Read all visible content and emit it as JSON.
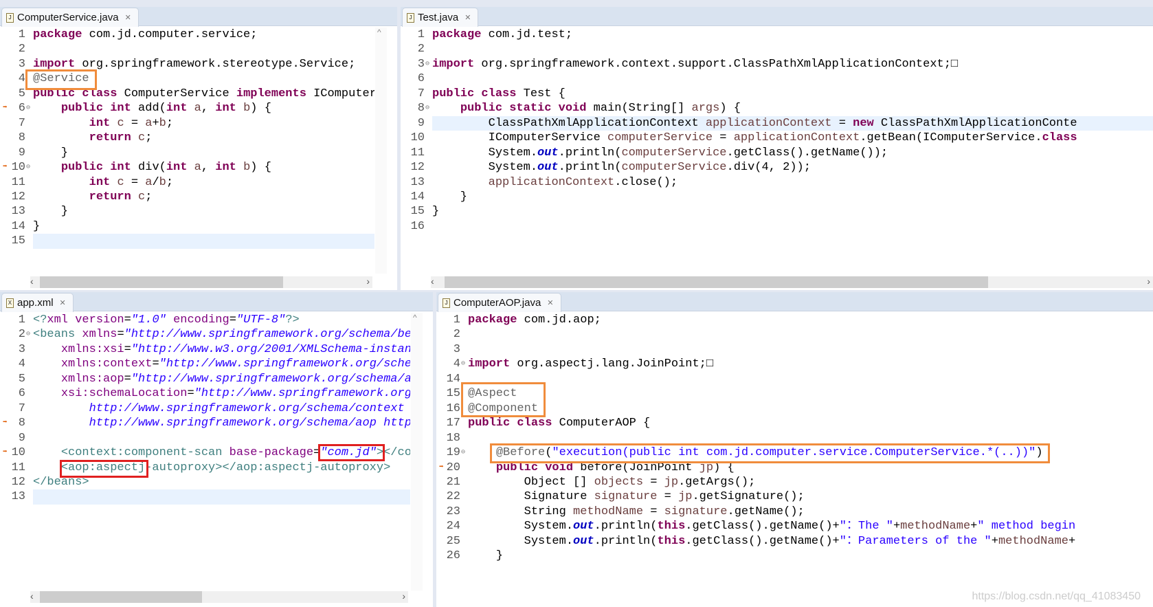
{
  "colors": {
    "highlight_orange": "#f08c3c",
    "highlight_red": "#e02020"
  },
  "panes": [
    {
      "id": "tl",
      "tab": "ComputerService.java",
      "icon": "java-file-icon",
      "current": 14,
      "lines": [
        [
          "1",
          [
            [
              "k",
              "package"
            ],
            [
              "p",
              " com.jd.computer.service;"
            ]
          ]
        ],
        [
          "2",
          []
        ],
        [
          "3",
          [
            [
              "k",
              "import"
            ],
            [
              "p",
              " org.springframework.stereotype.Service;"
            ]
          ]
        ],
        [
          "4",
          [
            [
              "a",
              "@Service"
            ]
          ]
        ],
        [
          "5",
          [
            [
              "k",
              "public"
            ],
            [
              "p",
              " "
            ],
            [
              "k",
              "class"
            ],
            [
              "p",
              " ComputerService "
            ],
            [
              "k",
              "implements"
            ],
            [
              "p",
              " IComputer"
            ]
          ]
        ],
        [
          "6",
          [
            [
              "p",
              "    "
            ],
            [
              "k",
              "public"
            ],
            [
              "p",
              " "
            ],
            [
              "k",
              "int"
            ],
            [
              "p",
              " add("
            ],
            [
              "k",
              "int"
            ],
            [
              "p",
              " "
            ],
            [
              "v",
              "a"
            ],
            [
              "p",
              ", "
            ],
            [
              "k",
              "int"
            ],
            [
              "p",
              " "
            ],
            [
              "v",
              "b"
            ],
            [
              "p",
              ") {"
            ]
          ]
        ],
        [
          "7",
          [
            [
              "p",
              "        "
            ],
            [
              "k",
              "int"
            ],
            [
              "p",
              " "
            ],
            [
              "v",
              "c"
            ],
            [
              "p",
              " = "
            ],
            [
              "v",
              "a"
            ],
            [
              "p",
              "+"
            ],
            [
              "v",
              "b"
            ],
            [
              "p",
              ";"
            ]
          ]
        ],
        [
          "8",
          [
            [
              "p",
              "        "
            ],
            [
              "k",
              "return"
            ],
            [
              "p",
              " "
            ],
            [
              "v",
              "c"
            ],
            [
              "p",
              ";"
            ]
          ]
        ],
        [
          "9",
          [
            [
              "p",
              "    }"
            ]
          ]
        ],
        [
          "10",
          [
            [
              "p",
              "    "
            ],
            [
              "k",
              "public"
            ],
            [
              "p",
              " "
            ],
            [
              "k",
              "int"
            ],
            [
              "p",
              " div("
            ],
            [
              "k",
              "int"
            ],
            [
              "p",
              " "
            ],
            [
              "v",
              "a"
            ],
            [
              "p",
              ", "
            ],
            [
              "k",
              "int"
            ],
            [
              "p",
              " "
            ],
            [
              "v",
              "b"
            ],
            [
              "p",
              ") {"
            ]
          ]
        ],
        [
          "11",
          [
            [
              "p",
              "        "
            ],
            [
              "k",
              "int"
            ],
            [
              "p",
              " "
            ],
            [
              "v",
              "c"
            ],
            [
              "p",
              " = "
            ],
            [
              "v",
              "a"
            ],
            [
              "p",
              "/"
            ],
            [
              "v",
              "b"
            ],
            [
              "p",
              ";"
            ]
          ]
        ],
        [
          "12",
          [
            [
              "p",
              "        "
            ],
            [
              "k",
              "return"
            ],
            [
              "p",
              " "
            ],
            [
              "v",
              "c"
            ],
            [
              "p",
              ";"
            ]
          ]
        ],
        [
          "13",
          [
            [
              "p",
              "    }"
            ]
          ]
        ],
        [
          "14",
          [
            [
              "p",
              "}"
            ]
          ]
        ],
        [
          "15",
          []
        ]
      ]
    },
    {
      "id": "tr",
      "tab": "Test.java",
      "icon": "java-file-icon",
      "current": 6,
      "lines": [
        [
          "1",
          [
            [
              "k",
              "package"
            ],
            [
              "p",
              " com.jd.test;"
            ]
          ]
        ],
        [
          "2",
          []
        ],
        [
          "3",
          [
            [
              "k",
              "import"
            ],
            [
              "p",
              " org.springframework.context.support.ClassPathXmlApplicationContext;□"
            ]
          ]
        ],
        [
          "6",
          []
        ],
        [
          "7",
          [
            [
              "k",
              "public"
            ],
            [
              "p",
              " "
            ],
            [
              "k",
              "class"
            ],
            [
              "p",
              " Test {"
            ]
          ]
        ],
        [
          "8",
          [
            [
              "p",
              "    "
            ],
            [
              "k",
              "public"
            ],
            [
              "p",
              " "
            ],
            [
              "k",
              "static"
            ],
            [
              "p",
              " "
            ],
            [
              "k",
              "void"
            ],
            [
              "p",
              " main(String[] "
            ],
            [
              "v",
              "args"
            ],
            [
              "p",
              ") {"
            ]
          ]
        ],
        [
          "9",
          [
            [
              "p",
              "        ClassPathXmlApplicationContext "
            ],
            [
              "v",
              "applicationContext"
            ],
            [
              "p",
              " = "
            ],
            [
              "k",
              "new"
            ],
            [
              "p",
              " ClassPathXmlApplicationConte"
            ]
          ]
        ],
        [
          "10",
          [
            [
              "p",
              "        IComputerService "
            ],
            [
              "v",
              "computerService"
            ],
            [
              "p",
              " = "
            ],
            [
              "v",
              "applicationContext"
            ],
            [
              "p",
              ".getBean(IComputerService."
            ],
            [
              "k",
              "class"
            ]
          ]
        ],
        [
          "11",
          [
            [
              "p",
              "        System."
            ],
            [
              "f",
              "out"
            ],
            [
              "p",
              ".println("
            ],
            [
              "v",
              "computerService"
            ],
            [
              "p",
              ".getClass().getName());"
            ]
          ]
        ],
        [
          "12",
          [
            [
              "p",
              "        System."
            ],
            [
              "f",
              "out"
            ],
            [
              "p",
              ".println("
            ],
            [
              "v",
              "computerService"
            ],
            [
              "p",
              ".div(4, 2));"
            ]
          ]
        ],
        [
          "13",
          [
            [
              "p",
              "        "
            ],
            [
              "v",
              "applicationContext"
            ],
            [
              "p",
              ".close();"
            ]
          ]
        ],
        [
          "14",
          [
            [
              "p",
              "    }"
            ]
          ]
        ],
        [
          "15",
          [
            [
              "p",
              "}"
            ]
          ]
        ],
        [
          "16",
          []
        ]
      ]
    },
    {
      "id": "bl",
      "tab": "app.xml",
      "icon": "xml-file-icon",
      "current": 12,
      "lines": [
        [
          "1",
          [
            [
              "t",
              "<?"
            ],
            [
              "n",
              "xml"
            ],
            [
              "p",
              " "
            ],
            [
              "n",
              "version"
            ],
            [
              "p",
              "="
            ],
            [
              "x",
              "\"1.0\""
            ],
            [
              "p",
              " "
            ],
            [
              "n",
              "encoding"
            ],
            [
              "p",
              "="
            ],
            [
              "x",
              "\"UTF-8\""
            ],
            [
              "t",
              "?>"
            ]
          ]
        ],
        [
          "2",
          [
            [
              "t",
              "<beans"
            ],
            [
              "p",
              " "
            ],
            [
              "n",
              "xmlns"
            ],
            [
              "p",
              "="
            ],
            [
              "x",
              "\"http://www.springframework.org/schema/be"
            ]
          ]
        ],
        [
          "3",
          [
            [
              "p",
              "    "
            ],
            [
              "n",
              "xmlns:xsi"
            ],
            [
              "p",
              "="
            ],
            [
              "x",
              "\"http://www.w3.org/2001/XMLSchema-instan"
            ]
          ]
        ],
        [
          "4",
          [
            [
              "p",
              "    "
            ],
            [
              "n",
              "xmlns:context"
            ],
            [
              "p",
              "="
            ],
            [
              "x",
              "\"http://www.springframework.org/sche"
            ]
          ]
        ],
        [
          "5",
          [
            [
              "p",
              "    "
            ],
            [
              "n",
              "xmlns:aop"
            ],
            [
              "p",
              "="
            ],
            [
              "x",
              "\"http://www.springframework.org/schema/a"
            ]
          ]
        ],
        [
          "6",
          [
            [
              "p",
              "    "
            ],
            [
              "n",
              "xsi:schemaLocation"
            ],
            [
              "p",
              "="
            ],
            [
              "x",
              "\"http://www.springframework.org"
            ]
          ]
        ],
        [
          "7",
          [
            [
              "p",
              "        "
            ],
            [
              "x",
              "http://www.springframework.org/schema/context"
            ]
          ]
        ],
        [
          "8",
          [
            [
              "p",
              "        "
            ],
            [
              "x",
              "http://www.springframework.org/schema/aop http"
            ]
          ]
        ],
        [
          "9",
          []
        ],
        [
          "10",
          [
            [
              "p",
              "    "
            ],
            [
              "t",
              "<context:component-scan"
            ],
            [
              "p",
              " "
            ],
            [
              "n",
              "base-package"
            ],
            [
              "p",
              "="
            ],
            [
              "x",
              "\"com.jd\""
            ],
            [
              "t",
              "></co"
            ]
          ]
        ],
        [
          "11",
          [
            [
              "p",
              "    "
            ],
            [
              "t",
              "<aop:aspectj-autoproxy></aop:aspectj-autoproxy>"
            ]
          ]
        ],
        [
          "12",
          [
            [
              "t",
              "</beans>"
            ]
          ]
        ],
        [
          "13",
          []
        ]
      ]
    },
    {
      "id": "br",
      "tab": "ComputerAOP.java",
      "icon": "java-file-icon",
      "current": -1,
      "lines": [
        [
          "1",
          [
            [
              "k",
              "package"
            ],
            [
              "p",
              " com.jd.aop;"
            ]
          ]
        ],
        [
          "2",
          []
        ],
        [
          "3",
          []
        ],
        [
          "4",
          [
            [
              "k",
              "import"
            ],
            [
              "p",
              " org.aspectj.lang.JoinPoint;□"
            ]
          ]
        ],
        [
          "14",
          []
        ],
        [
          "15",
          [
            [
              "a",
              "@Aspect"
            ]
          ]
        ],
        [
          "16",
          [
            [
              "a",
              "@Component"
            ]
          ]
        ],
        [
          "17",
          [
            [
              "k",
              "public"
            ],
            [
              "p",
              " "
            ],
            [
              "k",
              "class"
            ],
            [
              "p",
              " ComputerAOP {"
            ]
          ]
        ],
        [
          "18",
          []
        ],
        [
          "19",
          [
            [
              "p",
              "    "
            ],
            [
              "a",
              "@Before"
            ],
            [
              "p",
              "("
            ],
            [
              "s",
              "\"execution(public int com.jd.computer.service.ComputerService.*(..))\""
            ],
            [
              "p",
              ")"
            ]
          ]
        ],
        [
          "20",
          [
            [
              "p",
              "    "
            ],
            [
              "k",
              "public"
            ],
            [
              "p",
              " "
            ],
            [
              "k",
              "void"
            ],
            [
              "p",
              " before(JoinPoint "
            ],
            [
              "v",
              "jp"
            ],
            [
              "p",
              ") {"
            ]
          ]
        ],
        [
          "21",
          [
            [
              "p",
              "        Object [] "
            ],
            [
              "v",
              "objects"
            ],
            [
              "p",
              " = "
            ],
            [
              "v",
              "jp"
            ],
            [
              "p",
              ".getArgs();"
            ]
          ]
        ],
        [
          "22",
          [
            [
              "p",
              "        Signature "
            ],
            [
              "v",
              "signature"
            ],
            [
              "p",
              " = "
            ],
            [
              "v",
              "jp"
            ],
            [
              "p",
              ".getSignature();"
            ]
          ]
        ],
        [
          "23",
          [
            [
              "p",
              "        String "
            ],
            [
              "v",
              "methodName"
            ],
            [
              "p",
              " = "
            ],
            [
              "v",
              "signature"
            ],
            [
              "p",
              ".getName();"
            ]
          ]
        ],
        [
          "24",
          [
            [
              "p",
              "        System."
            ],
            [
              "f",
              "out"
            ],
            [
              "p",
              ".println("
            ],
            [
              "k",
              "this"
            ],
            [
              "p",
              ".getClass().getName()+"
            ],
            [
              "s",
              "\"：The \""
            ],
            [
              "p",
              "+"
            ],
            [
              "v",
              "methodName"
            ],
            [
              "p",
              "+"
            ],
            [
              "s",
              "\" method begin"
            ]
          ]
        ],
        [
          "25",
          [
            [
              "p",
              "        System."
            ],
            [
              "f",
              "out"
            ],
            [
              "p",
              ".println("
            ],
            [
              "k",
              "this"
            ],
            [
              "p",
              ".getClass().getName()+"
            ],
            [
              "s",
              "\"：Parameters of the \""
            ],
            [
              "p",
              "+"
            ],
            [
              "v",
              "methodName"
            ],
            [
              "p",
              "+"
            ]
          ]
        ],
        [
          "26",
          [
            [
              "p",
              "    }"
            ]
          ]
        ]
      ]
    }
  ],
  "watermark": "https://blog.csdn.net/qq_41083450"
}
